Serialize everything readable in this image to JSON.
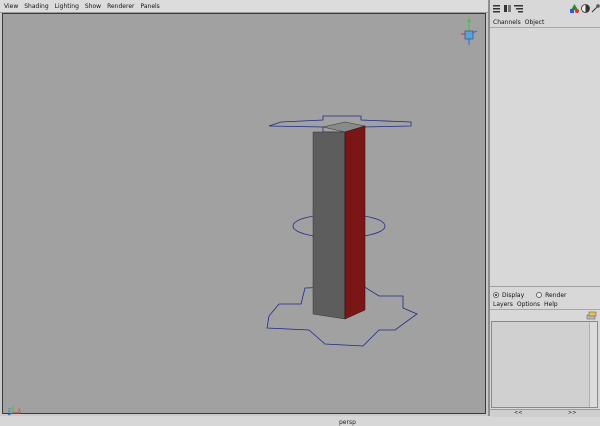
{
  "menu": [
    "View",
    "Shading",
    "Lighting",
    "Show",
    "Renderer",
    "Panels"
  ],
  "viewport": {
    "camera_label": "persp",
    "axis_labels": {
      "x": "X",
      "y": "Y",
      "z": "Z"
    },
    "colors": {
      "background": "#a1a1a1",
      "column_front": "#5d5d5d",
      "column_side": "#7a1616",
      "column_top": "#8a8a8a",
      "guide_lines": "#1e2a8a",
      "axis_x": "#d33",
      "axis_y": "#3c3",
      "axis_z": "#2b6cd6"
    }
  },
  "channel_box": {
    "tabs": [
      "Channels",
      "Object"
    ]
  },
  "layer_editor": {
    "display_option": "Display",
    "render_option": "Render",
    "menu": [
      "Layers",
      "Options",
      "Help"
    ],
    "nav_prev": "<<",
    "nav_next": ">>"
  }
}
